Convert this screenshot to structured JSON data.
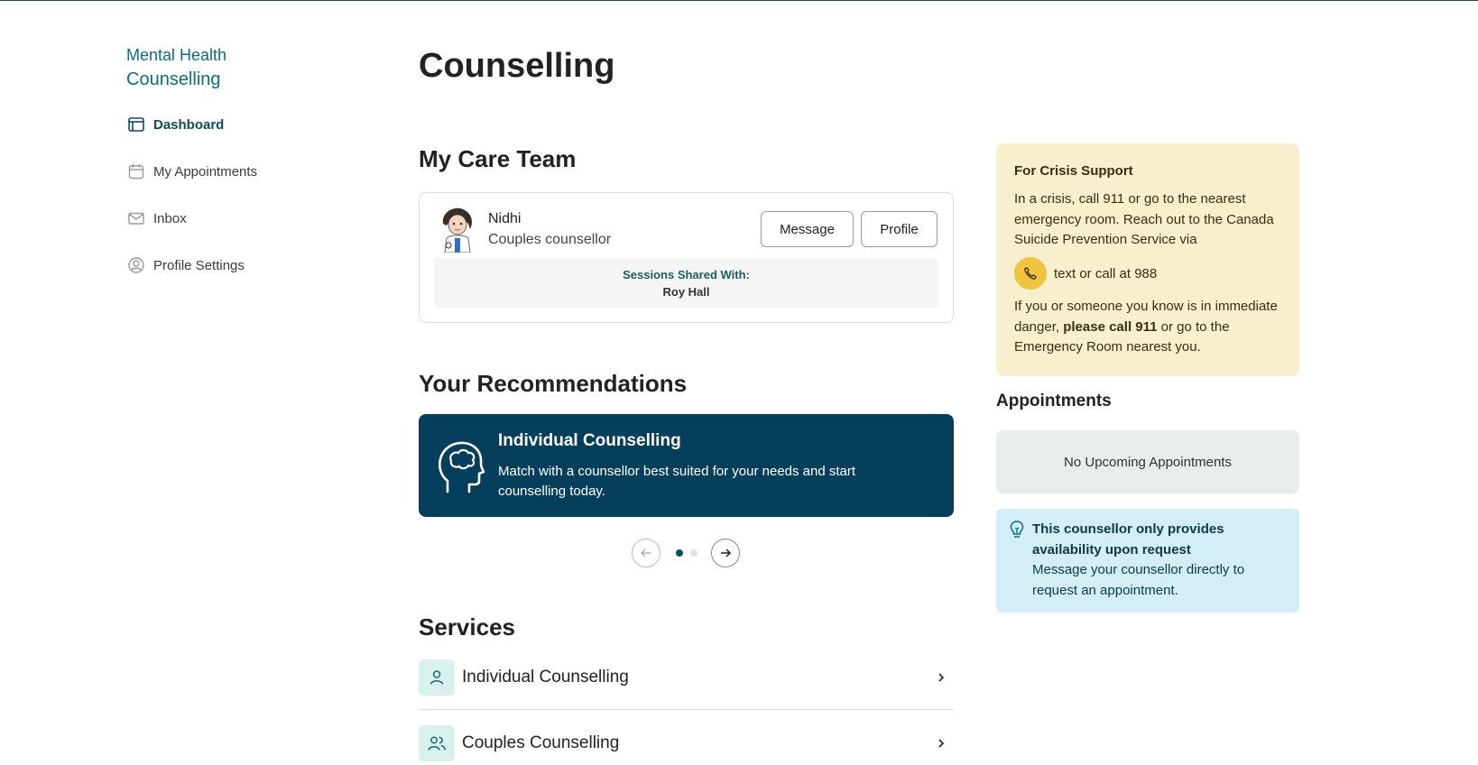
{
  "sidebar": {
    "brand_line1": "Mental Health",
    "brand_line2": "Counselling",
    "items": [
      {
        "label": "Dashboard",
        "icon": "dashboard-icon",
        "active": true
      },
      {
        "label": "My Appointments",
        "icon": "calendar-icon",
        "active": false
      },
      {
        "label": "Inbox",
        "icon": "mail-icon",
        "active": false
      },
      {
        "label": "Profile Settings",
        "icon": "user-circle-icon",
        "active": false
      }
    ]
  },
  "main": {
    "title": "Counselling",
    "care_team": {
      "heading": "My Care Team",
      "counsellor_name": "Nidhi",
      "counsellor_role": "Couples counsellor",
      "message_label": "Message",
      "profile_label": "Profile",
      "shared_label": "Sessions Shared With:",
      "shared_name": "Roy Hall"
    },
    "recommendations": {
      "heading": "Your Recommendations",
      "card_title": "Individual Counselling",
      "card_desc": "Match with a counsellor best suited for your needs and start counselling today.",
      "active_slide": 1,
      "total_slides": 2
    },
    "services": {
      "heading": "Services",
      "items": [
        {
          "label": "Individual Counselling",
          "icon": "person-icon"
        },
        {
          "label": "Couples Counselling",
          "icon": "people-icon"
        }
      ]
    }
  },
  "right": {
    "crisis": {
      "heading": "For Crisis Support",
      "text1": "In a crisis, call 911 or go to the nearest emergency room. Reach out to the Canada Suicide Prevention Service via",
      "phone_text": "text or call at 988",
      "text2_pre": "If you or someone you know is in immediate danger, ",
      "text2_bold": "please call 911",
      "text2_post": " or go to the Emergency Room nearest you."
    },
    "appointments": {
      "heading": "Appointments",
      "empty_text": "No Upcoming Appointments"
    },
    "tip": {
      "title": "This counsellor only provides availability upon request",
      "desc": "Message your counsellor directly to request an appointment."
    }
  },
  "colors": {
    "brand": "#0d6b86",
    "primary_dark": "#053f5c",
    "crisis_bg": "#f8efcf",
    "phone_accent": "#f2c33e",
    "tip_bg": "#d3eef7",
    "service_icon_bg": "#d9f1ee"
  }
}
